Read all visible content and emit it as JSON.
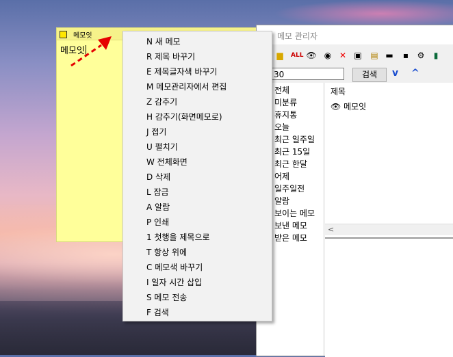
{
  "memo": {
    "title": "메모잇",
    "body_text": "메모잇"
  },
  "manager": {
    "title": "메모 관리자",
    "search": {
      "value": "30",
      "button_label": "검색"
    },
    "nav": {
      "down": "v",
      "up": "^"
    },
    "toolbar_icons": [
      "folder-icon",
      "all-icon",
      "eye-icon",
      "eye-outline-icon",
      "delete-icon",
      "monitor-icon",
      "note-icon",
      "tape-icon",
      "save-icon",
      "gear-icon",
      "exit-icon"
    ],
    "categories": [
      "전체",
      "미분류",
      "휴지통",
      "오늘",
      "최근 일주일",
      "최근 15일",
      "최근 한달",
      "어제",
      "일주일전",
      "알람",
      "보이는 메모",
      "보낸 메모",
      "받은 메모"
    ],
    "list": {
      "column_title": "제목",
      "rows": [
        {
          "title": "메모잇"
        }
      ]
    }
  },
  "context_menu": {
    "items": [
      "N 새 메모",
      "R 제목 바꾸기",
      "E 제목글자색 바꾸기",
      "M 메모관리자에서 편집",
      "Z 감추기",
      "H 감추기(화면메모로)",
      "J 접기",
      "U 펼치기",
      "W 전체화면",
      "D 삭제",
      "L 잠금",
      "A 알람",
      "P 인쇄",
      "1 첫행을 제목으로",
      "T 항상 위에",
      "C 메모색 바꾸기",
      "I 일자 시간 삽입",
      "S 메모 전송",
      "F 검색"
    ]
  },
  "colors": {
    "memo_bg": "#ffff9a",
    "accent": "#1c4fd0",
    "arrow": "#e60000"
  }
}
